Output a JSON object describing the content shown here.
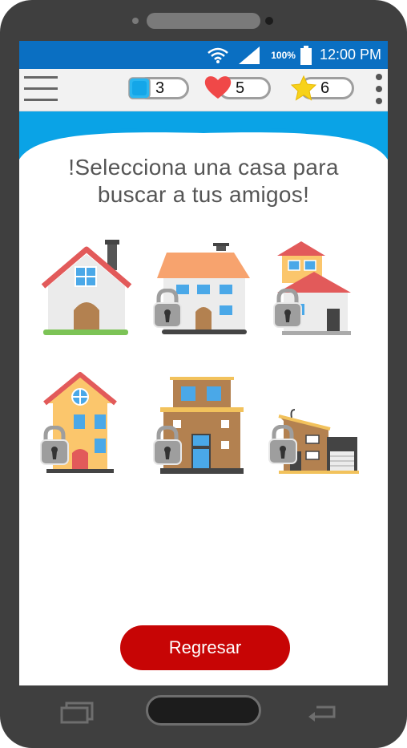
{
  "status_bar": {
    "battery_percent": "100%",
    "time": "12:00 PM",
    "icons": [
      "wifi-icon",
      "signal-icon",
      "battery-icon"
    ]
  },
  "top_bar": {
    "menu_icon": "hamburger-menu-icon",
    "counters": [
      {
        "icon": "blue-square-icon",
        "value": "3"
      },
      {
        "icon": "heart-icon",
        "value": "5"
      },
      {
        "icon": "star-icon",
        "value": "6"
      }
    ],
    "more_icon": "kebab-menu-icon"
  },
  "main": {
    "title_line1": "!Selecciona una casa para",
    "title_line2": "buscar a tus amigos!",
    "houses": [
      {
        "icon": "house-icon",
        "locked": false
      },
      {
        "icon": "house-icon",
        "locked": true
      },
      {
        "icon": "house-icon",
        "locked": true
      },
      {
        "icon": "house-icon",
        "locked": true
      },
      {
        "icon": "building-icon",
        "locked": true
      },
      {
        "icon": "modern-house-icon",
        "locked": true
      }
    ]
  },
  "back_button": {
    "label": "Regresar"
  },
  "nav_bar": {
    "icons": [
      "recent-apps-icon",
      "home-button",
      "back-icon"
    ]
  },
  "colors": {
    "status_bar": "#0a6fc2",
    "wave": "#0aa3e6",
    "button": "#c70505",
    "phone": "#3f3f3f"
  }
}
